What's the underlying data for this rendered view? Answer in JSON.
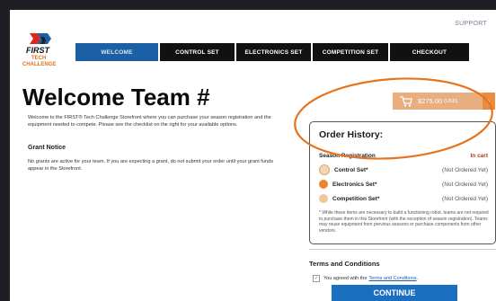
{
  "header": {
    "support": "SUPPORT"
  },
  "logo": {
    "first": "FIRST",
    "tech": "TECH",
    "challenge": "CHALLENGE"
  },
  "nav": [
    {
      "label": "WELCOME",
      "active": true
    },
    {
      "label": "CONTROL SET",
      "active": false
    },
    {
      "label": "ELECTRONICS SET",
      "active": false
    },
    {
      "label": "COMPETITION SET",
      "active": false
    },
    {
      "label": "CHECKOUT",
      "active": false
    }
  ],
  "main": {
    "title": "Welcome Team #",
    "intro": "Welcome to the FIRST® Tech Challenge Storefront where you can purchase your season registration and the equipment needed to compete. Please see the checklist on the right for your available options.",
    "grant_heading": "Grant Notice",
    "grant_text": "No grants are active for your team. If you are expecting a grant, do not submit your order until your grant funds appear in the Storefront."
  },
  "cart": {
    "amount": "$275.00",
    "currency": "(USD)",
    "icon": "shopping-cart-icon"
  },
  "orders": {
    "title": "Order History:",
    "items": [
      {
        "name": "Season Registration",
        "status": "In cart",
        "icon": ""
      },
      {
        "name": "Control Set*",
        "status": "(Not Ordered Yet)",
        "icon": "tool-icon"
      },
      {
        "name": "Electronics Set*",
        "status": "(Not Ordered Yet)",
        "icon": "chip-icon"
      },
      {
        "name": "Competition Set*",
        "status": "(Not Ordered Yet)",
        "icon": "gear-icon"
      }
    ],
    "note": "* While these items are necessary to build a functioning robot, teams are not required to purchase them in this Storefront (with the exception of season registration). Teams may reuse equipment from previous seasons or purchase components from other vendors."
  },
  "terms": {
    "heading": "Terms and Conditions",
    "agreed_prefix": "You agreed with the",
    "link": "Terms and Conditions",
    "suffix": "."
  },
  "continue_label": "CONTINUE",
  "colors": {
    "nav_active": "#1b5fa5",
    "nav": "#111111",
    "cart": "#e9ae7f",
    "highlight": "#e8731f",
    "continue": "#1b6fc0"
  }
}
